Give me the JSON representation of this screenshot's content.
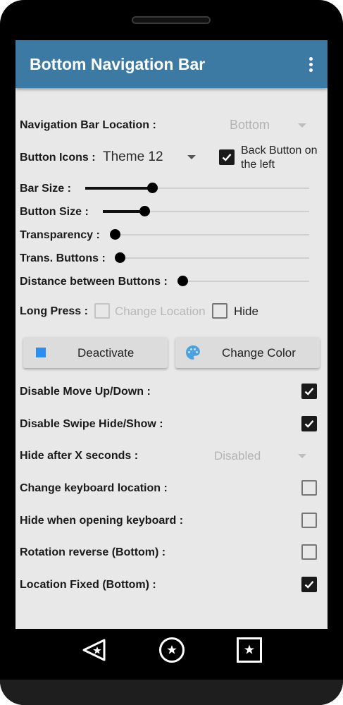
{
  "app": {
    "title": "Bottom Navigation Bar"
  },
  "settings": {
    "nav_location_label": "Navigation Bar Location :",
    "nav_location_value": "Bottom",
    "button_icons_label": "Button Icons :",
    "button_icons_value": "Theme 12",
    "back_button_left_line1": "Back Button on",
    "back_button_left_line2": "the left",
    "back_button_left_checked": true,
    "bar_size_label": "Bar Size :",
    "bar_size_value": 0.3,
    "button_size_label": "Button Size :",
    "button_size_value": 0.2,
    "transparency_label": "Transparency :",
    "transparency_value": 0.0,
    "trans_buttons_label": "Trans. Buttons :",
    "trans_buttons_value": 0.0,
    "distance_label": "Distance between Buttons :",
    "distance_value": 0.0,
    "long_press_label": "Long Press :",
    "change_location_label": "Change Location",
    "change_location_checked": false,
    "hide_label": "Hide",
    "hide_checked": false
  },
  "actions": {
    "deactivate_label": "Deactivate",
    "change_color_label": "Change Color"
  },
  "toggles": {
    "disable_move_label": "Disable Move Up/Down :",
    "disable_move_checked": true,
    "disable_swipe_label": "Disable Swipe Hide/Show :",
    "disable_swipe_checked": true,
    "hide_after_label": "Hide after X seconds :",
    "hide_after_value": "Disabled",
    "change_keyboard_label": "Change keyboard location :",
    "change_keyboard_checked": false,
    "hide_keyboard_label": "Hide when opening keyboard :",
    "hide_keyboard_checked": false,
    "rotation_label": "Rotation reverse (Bottom) :",
    "rotation_checked": false,
    "location_fixed_label": "Location Fixed (Bottom) :",
    "location_fixed_checked": true
  },
  "colors": {
    "appbar": "#3d7aa3",
    "accent_square": "#2d8ef0",
    "palette_icon": "#4aa3df"
  },
  "icons": [
    "more-vert-icon",
    "stop-square-icon",
    "palette-icon",
    "back-triangle-icon",
    "home-circle-star-icon",
    "recents-square-star-icon"
  ]
}
